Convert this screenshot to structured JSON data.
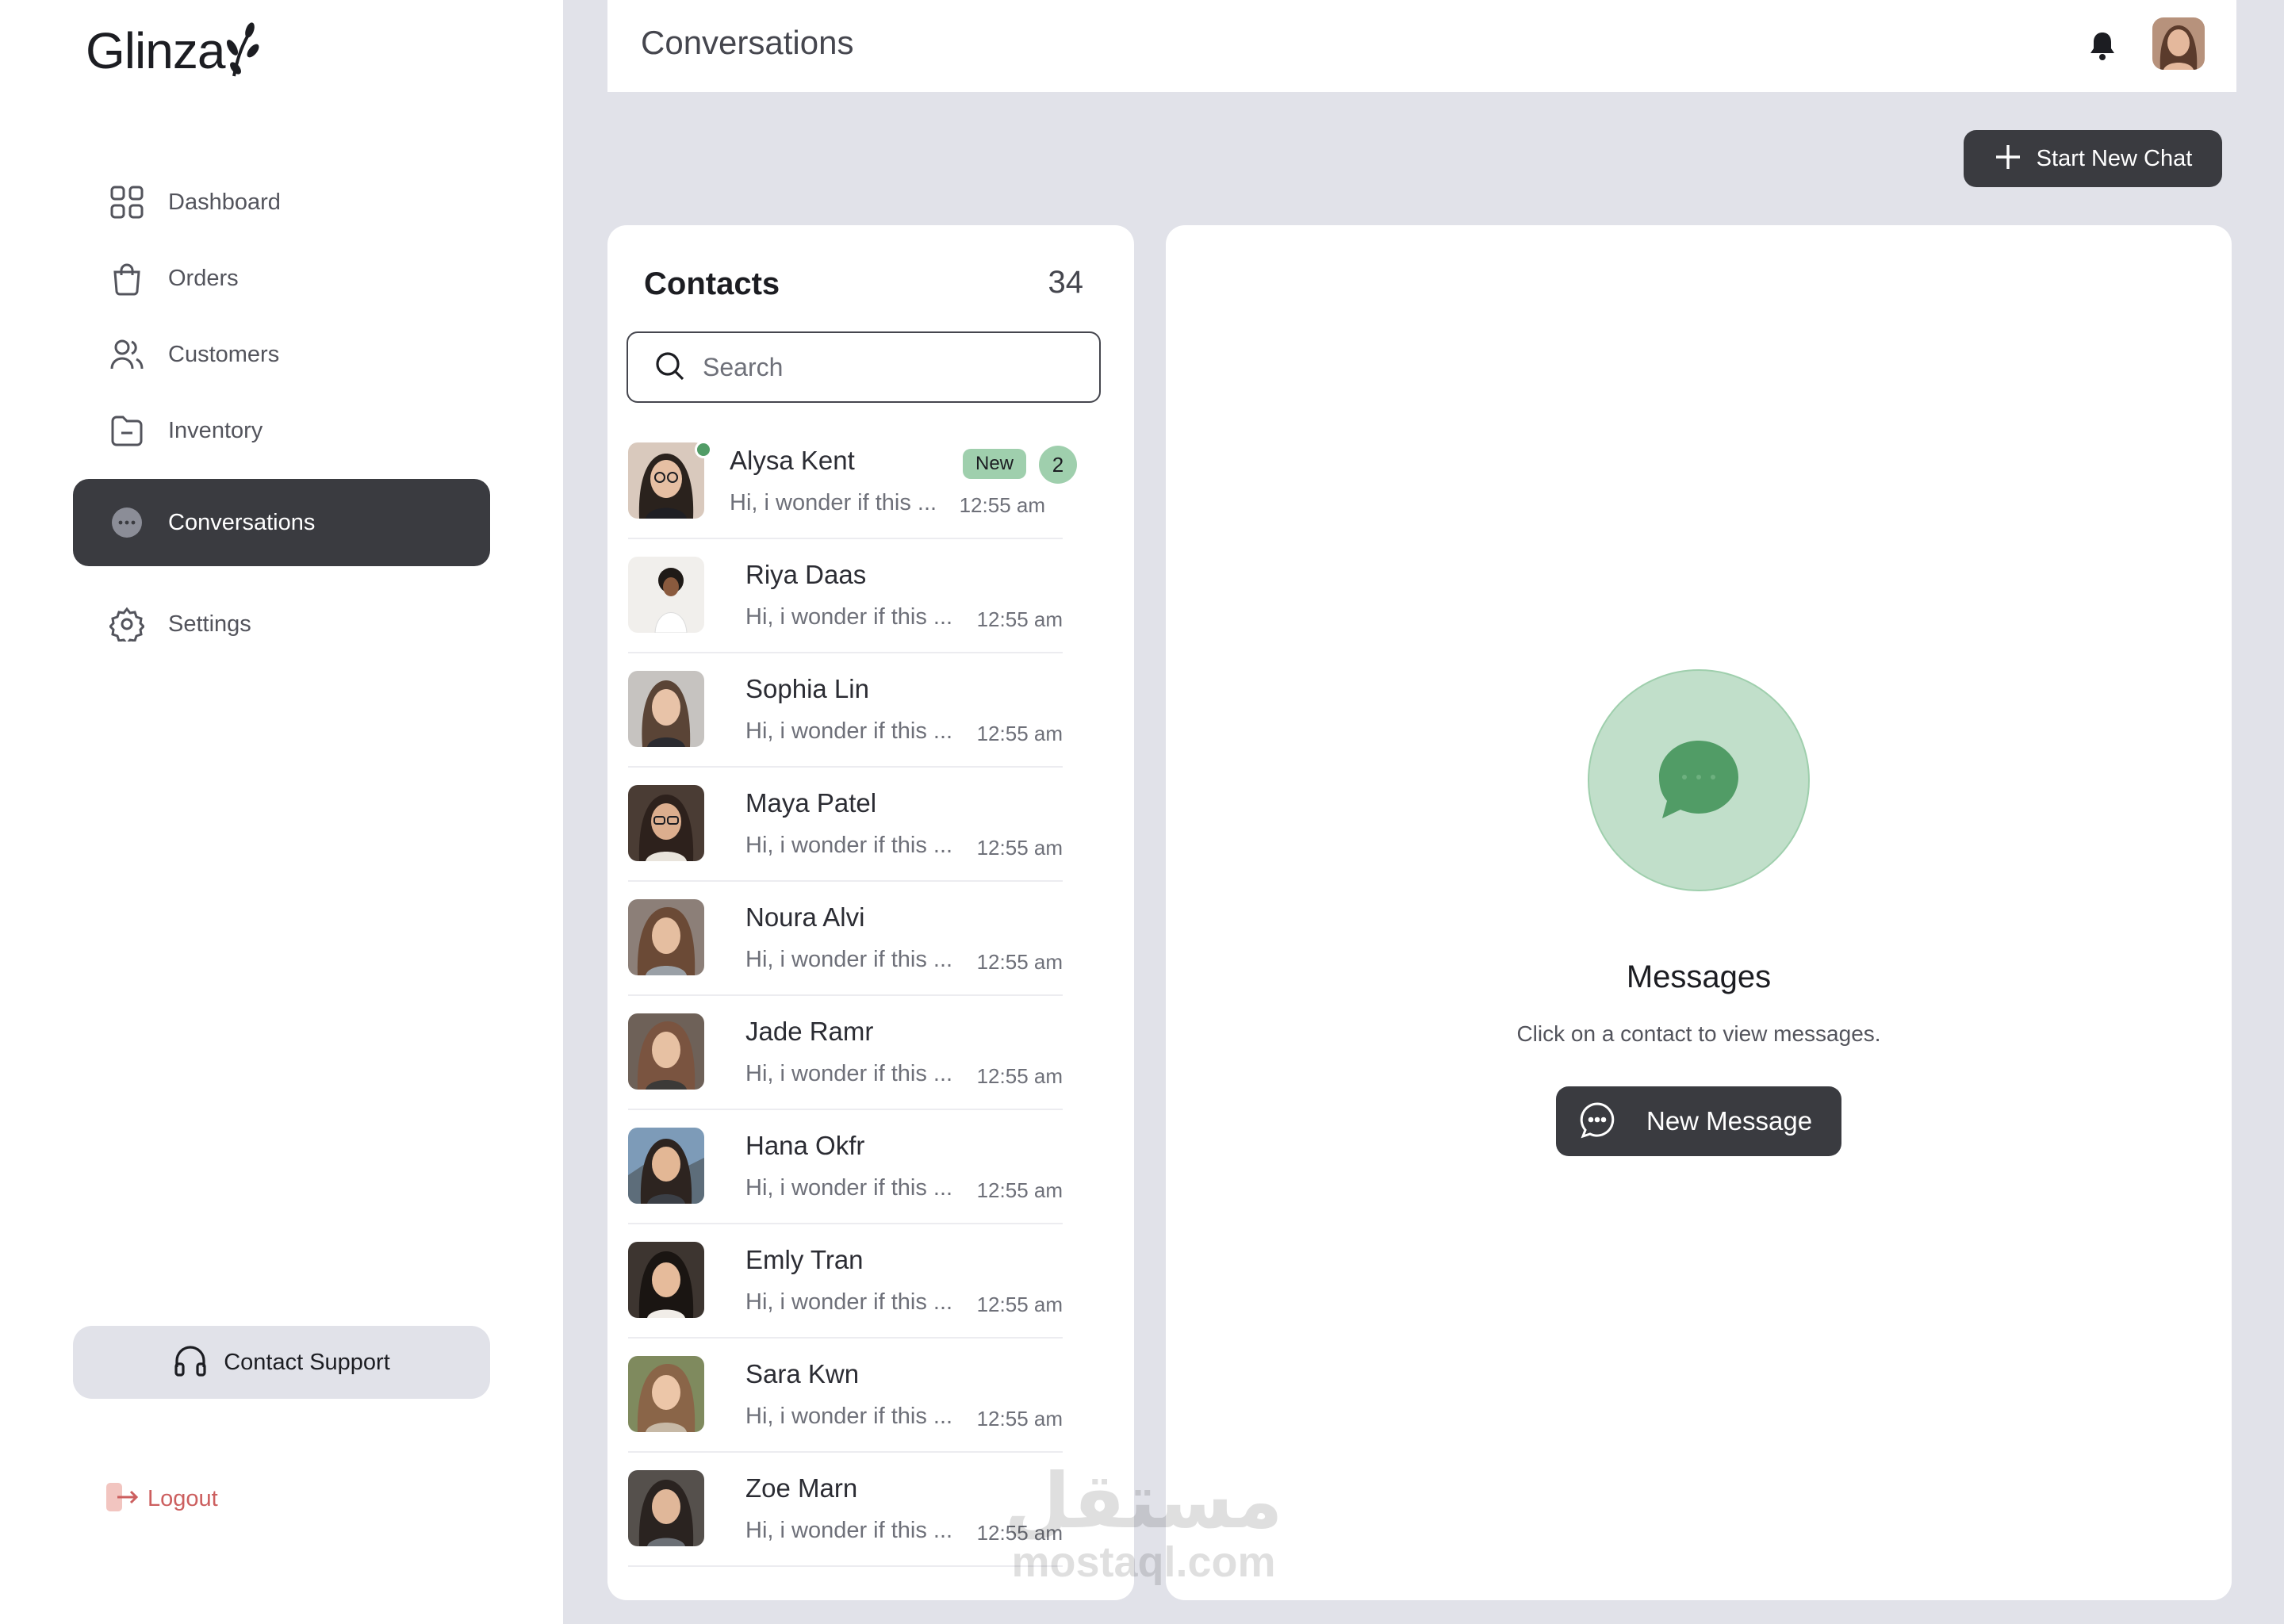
{
  "app": {
    "brand": "Glinza"
  },
  "sidebar": {
    "items": [
      {
        "label": "Dashboard",
        "icon": "dashboard-icon",
        "active": false
      },
      {
        "label": "Orders",
        "icon": "bag-icon",
        "active": false
      },
      {
        "label": "Customers",
        "icon": "users-icon",
        "active": false
      },
      {
        "label": "Inventory",
        "icon": "folder-icon",
        "active": false
      },
      {
        "label": "Conversations",
        "icon": "chat-icon",
        "active": true
      },
      {
        "label": "Settings",
        "icon": "gear-icon",
        "active": false
      }
    ],
    "support_label": "Contact Support",
    "logout_label": "Logout"
  },
  "header": {
    "title": "Conversations"
  },
  "actions": {
    "start_chat_label": "Start New Chat"
  },
  "contacts": {
    "title": "Contacts",
    "count": "34",
    "search_placeholder": "Search",
    "list": [
      {
        "name": "Alysa Kent",
        "preview": "Hi, i wonder if this ...",
        "time": "12:55 am",
        "badge": "New",
        "unread": "2",
        "online": true
      },
      {
        "name": "Riya Daas",
        "preview": "Hi, i wonder if this ...",
        "time": "12:55 am"
      },
      {
        "name": "Sophia Lin",
        "preview": "Hi, i wonder if this ...",
        "time": "12:55 am"
      },
      {
        "name": "Maya Patel",
        "preview": "Hi, i wonder if this ...",
        "time": "12:55 am"
      },
      {
        "name": "Noura Alvi",
        "preview": "Hi, i wonder if this ...",
        "time": "12:55 am"
      },
      {
        "name": "Jade Ramr",
        "preview": "Hi, i wonder if this ...",
        "time": "12:55 am"
      },
      {
        "name": "Hana Okfr",
        "preview": "Hi, i wonder if this ...",
        "time": "12:55 am"
      },
      {
        "name": "Emly Tran",
        "preview": "Hi, i wonder if this ...",
        "time": "12:55 am"
      },
      {
        "name": "Sara Kwn",
        "preview": "Hi, i wonder if this ...",
        "time": "12:55 am"
      },
      {
        "name": "Zoe Marn",
        "preview": "Hi, i wonder if this ...",
        "time": "12:55 am"
      }
    ]
  },
  "messages": {
    "title": "Messages",
    "subtitle": "Click on a contact to view messages.",
    "new_message_label": "New Message"
  },
  "watermark": {
    "line1": "مستقل",
    "line2": "mostaql.com"
  },
  "colors": {
    "dark": "#3a3b40",
    "accent_green": "#519c66",
    "soft_green": "#c1dfca",
    "background": "#e1e2e9",
    "logout": "#cc5f5f"
  }
}
